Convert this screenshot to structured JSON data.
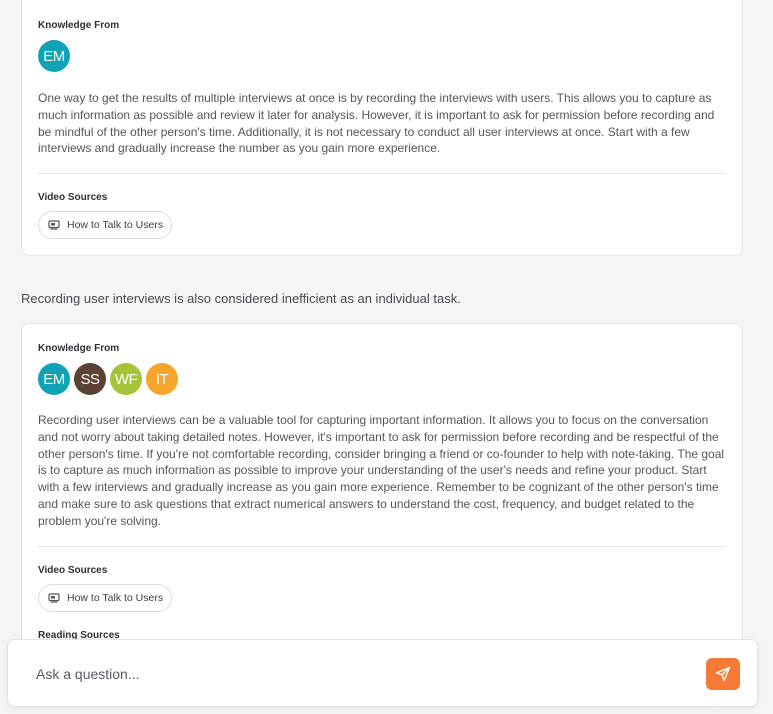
{
  "card1": {
    "knowledge_label": "Knowledge From",
    "avatars": [
      {
        "initials": "EM",
        "color": "#0fa3b5"
      }
    ],
    "text": "One way to get the results of multiple interviews at once is by recording the interviews with users. This allows you to capture as much information as possible and review it later for analysis. However, it is important to ask for permission before recording and be mindful of the other person's time. Additionally, it is not necessary to conduct all user interviews at once. Start with a few interviews and gradually increase the number as you gain more experience.",
    "video_label": "Video Sources",
    "video_chip": "How to Talk to Users"
  },
  "between_text": "Recording user interviews is also considered inefficient as an individual task.",
  "card2": {
    "knowledge_label": "Knowledge From",
    "avatars": [
      {
        "initials": "EM",
        "color": "#0fa3b5"
      },
      {
        "initials": "SS",
        "color": "#5b4232"
      },
      {
        "initials": "WF",
        "color": "#a5c43a"
      },
      {
        "initials": "IT",
        "color": "#f7a52a"
      }
    ],
    "text": "Recording user interviews can be a valuable tool for capturing important information. It allows you to focus on the conversation and not worry about taking detailed notes. However, it's important to ask for permission before recording and be respectful of the other person's time. If you're not comfortable recording, consider bringing a friend or co-founder to help with note-taking. The goal is to capture as much information as possible to improve your understanding of the user's needs and refine your product. Start with a few interviews and gradually increase as you gain more experience. Remember to be cognizant of the other person's time and make sure to ask questions that extract numerical answers to understand the cost, frequency, and budget related to the problem you're solving.",
    "video_label": "Video Sources",
    "video_chip": "How to Talk to Users",
    "reading_label": "Reading Sources"
  },
  "ask": {
    "placeholder": "Ask a question..."
  },
  "icons": {
    "chip": "video-screen-icon",
    "send": "send-plane-icon"
  },
  "colors": {
    "accent": "#f47a36"
  }
}
